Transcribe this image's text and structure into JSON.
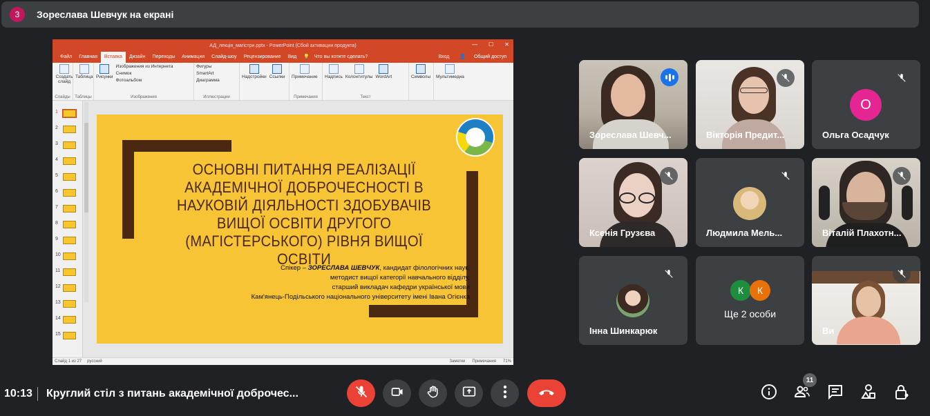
{
  "banner": {
    "count": "3",
    "title": "Зореслава Шевчук на екрані"
  },
  "powerpoint": {
    "window_title": "АД_лекція_магістри.pptx - PowerPoint (Сбой активации продукта)",
    "tabs": [
      "Файл",
      "Главная",
      "Вставка",
      "Дизайн",
      "Переходы",
      "Анимация",
      "Слайд-шоу",
      "Рецензирование",
      "Вид"
    ],
    "active_tab": "Вставка",
    "tell_me": "Что вы хотите сделать?",
    "sign_in": "Вход",
    "share": "Общий доступ",
    "ribbon": {
      "new_slide": "Создать слайд",
      "slides_group": "Слайды",
      "table": "Таблица",
      "tables_group": "Таблицы",
      "pictures": "Рисунки",
      "online_pictures": "Изображения из Интернета",
      "screenshot": "Снимок",
      "photo_album": "Фотоальбом",
      "images_group": "Изображения",
      "shapes": "Фигуры",
      "smartart": "SmartArt",
      "chart": "Диаграмма",
      "illustrations_group": "Иллюстрации",
      "addins": "Надстройки",
      "links": "Ссылки",
      "comment": "Примечание",
      "comments_group": "Примечания",
      "textbox": "Надпись",
      "header_footer": "Колонтитулы",
      "wordart": "WordArt",
      "text_group": "Текст",
      "symbols": "Символы",
      "multimedia": "Мультимедиа"
    },
    "thumbnails": [
      "1",
      "2",
      "3",
      "4",
      "5",
      "6",
      "7",
      "8",
      "9",
      "10",
      "11",
      "12",
      "13",
      "14",
      "15"
    ],
    "slide": {
      "title": "Основні питання реалізації академічної доброчесності в науковій діяльності здобувачів вищої освіти другого (магістерського) рівня вищої освіти",
      "speaker_prefix": "Спікер – ",
      "speaker_name": "ЗОРЕСЛАВА ШЕВЧУК",
      "speaker_rest": ", кандидат філологічних наук,",
      "line2": "методист вищої категорії навчального відділу,",
      "line3": "старший викладач кафедри української мови",
      "line4": "Кам'янець-Подільського національного університету імені Івана Огієнка"
    },
    "status": {
      "slide_of": "Слайд 1 из 27",
      "lang": "русский",
      "notes": "Заметки",
      "comments": "Примечания",
      "zoom": "71%"
    }
  },
  "participants": [
    {
      "name": "Зореслава Шевч...",
      "speaking": true
    },
    {
      "name": "Вікторія Предит..."
    },
    {
      "name": "Ольга Осадчук",
      "initial": "О",
      "avatar_color": "#e52592"
    },
    {
      "name": "Ксенія Грузєва"
    },
    {
      "name": "Людмила Мель..."
    },
    {
      "name": "Віталій Плахотн..."
    },
    {
      "name": "Інна Шинкарюк"
    },
    {
      "name": "Ще 2 особи",
      "initials": [
        "К",
        "К"
      ],
      "avatar_colors": [
        "#1e8e3e",
        "#e8710a"
      ]
    },
    {
      "name": "Ви"
    }
  ],
  "bottom": {
    "time": "10:13",
    "meeting": "Круглий стіл з питань академічної доброчес...",
    "participants_count": "11"
  },
  "colors": {
    "background": "#202124",
    "tile": "#3c4043",
    "end_call": "#ea4335",
    "slide_yellow": "#f7c436",
    "slide_brown": "#4a2812",
    "ppt_orange": "#d24726"
  }
}
